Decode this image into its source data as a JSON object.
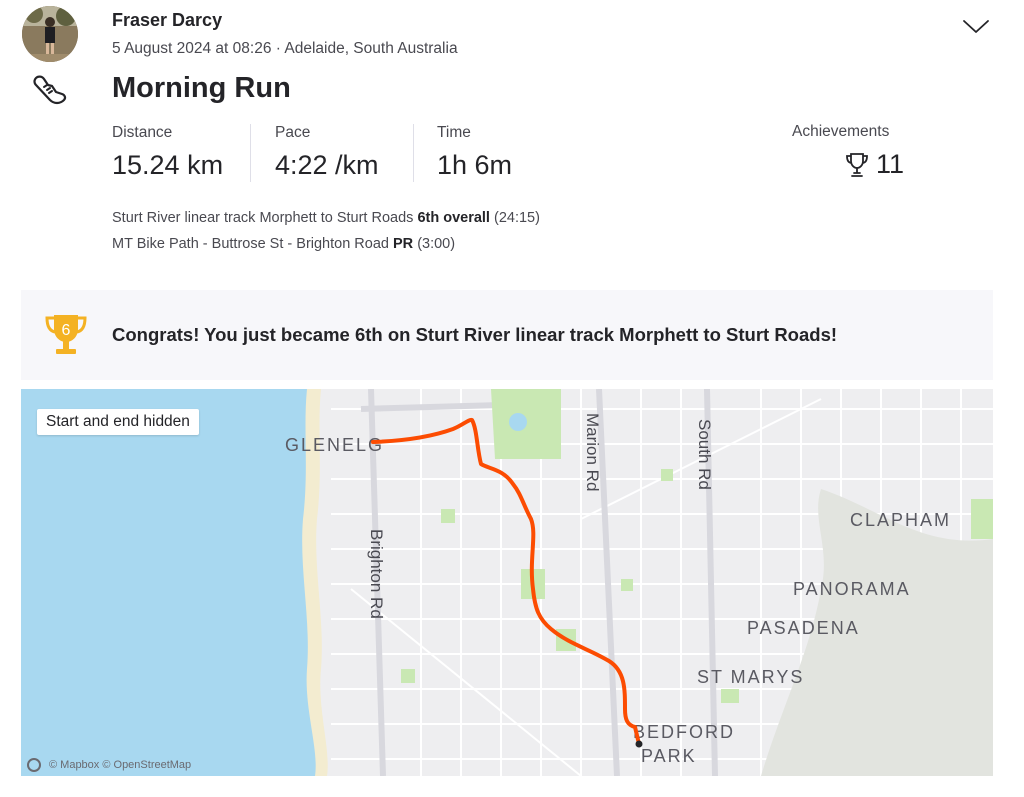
{
  "athlete": {
    "name": "Fraser Darcy"
  },
  "activity": {
    "meta": "5 August 2024 at 08:26 · Adelaide, South Australia",
    "title": "Morning Run",
    "sport_icon": "running-shoe-icon"
  },
  "stats": [
    {
      "label": "Distance",
      "value": "15.24 km"
    },
    {
      "label": "Pace",
      "value": "4:22 /km"
    },
    {
      "label": "Time",
      "value": "1h 6m"
    }
  ],
  "achievements": {
    "label": "Achievements",
    "value": "11",
    "icon": "trophy-icon"
  },
  "efforts": [
    {
      "segment": "Sturt River linear track Morphett to Sturt Roads",
      "result": "6th overall",
      "time": "(24:15)"
    },
    {
      "segment": "MT Bike Path - Buttrose St - Brighton Road",
      "result": "PR",
      "time": "(3:00)"
    }
  ],
  "congrats": {
    "rank": "6",
    "text": "Congrats! You just became 6th on Sturt River linear track Morphett to Sturt Roads!"
  },
  "map": {
    "privacy_badge": "Start and end hidden",
    "attribution": "© Mapbox © OpenStreetMap",
    "labels": {
      "glenelg": "GLENELG",
      "brighton_rd": "Brighton Rd",
      "marion_rd": "Marion Rd",
      "south_rd": "South Rd",
      "clapham": "CLAPHAM",
      "panorama": "PANORAMA",
      "pasadena": "PASADENA",
      "st_marys": "ST MARYS",
      "bedford": "BEDFORD",
      "park": "PARK"
    }
  },
  "colors": {
    "route": "#fc4c02",
    "sea": "#a8d8f0",
    "trophy_gold": "#f4b223",
    "park_green": "#c9e8b3"
  }
}
